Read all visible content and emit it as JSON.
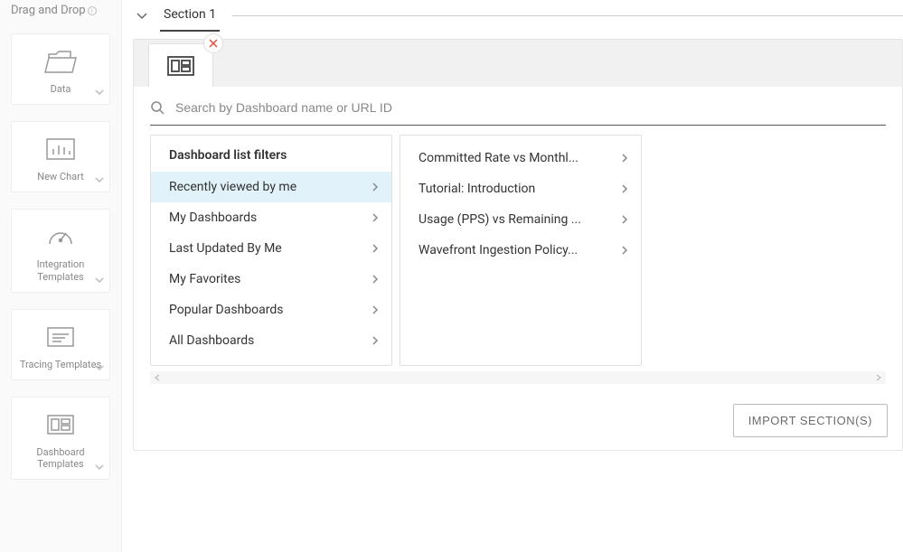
{
  "sidebar": {
    "title": "Drag and Drop",
    "items": [
      {
        "label": "Data"
      },
      {
        "label": "New Chart"
      },
      {
        "label": "Integration Templates"
      },
      {
        "label": "Tracing Templates"
      },
      {
        "label": "Dashboard Templates"
      }
    ]
  },
  "section": {
    "title": "Section 1"
  },
  "search": {
    "placeholder": "Search by Dashboard name or URL ID"
  },
  "filters": {
    "heading": "Dashboard list filters",
    "items": [
      "Recently viewed by me",
      "My Dashboards",
      "Last Updated By Me",
      "My Favorites",
      "Popular Dashboards",
      "All Dashboards"
    ],
    "selectedIndex": 0
  },
  "results": {
    "items": [
      "Committed Rate vs Monthl...",
      "Tutorial: Introduction",
      "Usage (PPS) vs Remaining ...",
      "Wavefront Ingestion Policy..."
    ]
  },
  "footer": {
    "importLabel": "IMPORT SECTION(S)"
  }
}
